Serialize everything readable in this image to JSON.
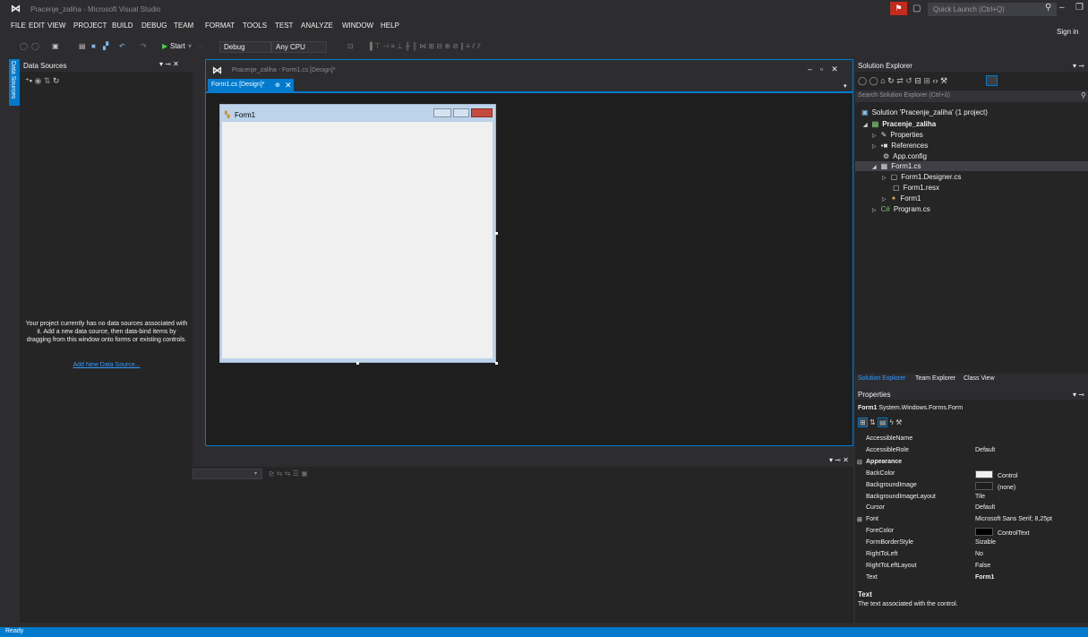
{
  "window": {
    "title": "Pracenje_zaliha - Microsoft Visual Studio",
    "quick_launch_placeholder": "Quick Launch (Ctrl+Q)",
    "sign_in": "Sign in"
  },
  "menu": [
    "FILE",
    "EDIT",
    "VIEW",
    "PROJECT",
    "BUILD",
    "DEBUG",
    "TEAM",
    "FORMAT",
    "TOOLS",
    "TEST",
    "ANALYZE",
    "WINDOW",
    "HELP"
  ],
  "toolbar": {
    "start_label": "Start",
    "config": "Debug",
    "platform": "Any CPU"
  },
  "data_sources": {
    "side_tab": "Data Sources",
    "title": "Data Sources",
    "empty_message": "Your project currently has no data sources associated with it. Add a new data source, then data-bind items by dragging from this window onto forms or existing controls.",
    "add_link": "Add New Data Source..."
  },
  "designer": {
    "doc_title": "Pracenje_zaliha - Form1.cs [Design]*",
    "tab_label": "Form1.cs [Design]*",
    "form_title": "Form1"
  },
  "solution_explorer": {
    "title": "Solution Explorer",
    "search_placeholder": "Search Solution Explorer (Ctrl+ŭ)",
    "nodes": {
      "solution": "Solution 'Pracenje_zaliha' (1 project)",
      "project": "Pracenje_zaliha",
      "properties": "Properties",
      "references": "References",
      "appconfig": "App.config",
      "form1cs": "Form1.cs",
      "designer": "Form1.Designer.cs",
      "resx": "Form1.resx",
      "form1": "Form1",
      "program": "Program.cs"
    },
    "tabs": [
      "Solution Explorer",
      "Team Explorer",
      "Class View"
    ]
  },
  "properties": {
    "title": "Properties",
    "object_name": "Form1",
    "object_type": "System.Windows.Forms.Form",
    "rows": [
      {
        "name": "AccessibleName",
        "value": ""
      },
      {
        "name": "AccessibleRole",
        "value": "Default"
      },
      {
        "category": "Appearance"
      },
      {
        "name": "BackColor",
        "value": "Control",
        "swatch": "#f0f0f0"
      },
      {
        "name": "BackgroundImage",
        "value": "(none)",
        "swatch": "#1e1e1e"
      },
      {
        "name": "BackgroundImageLayout",
        "value": "Tile"
      },
      {
        "name": "Cursor",
        "value": "Default"
      },
      {
        "name": "Font",
        "value": "Microsoft Sans Serif; 8,25pt",
        "expandable": true
      },
      {
        "name": "ForeColor",
        "value": "ControlText",
        "swatch": "#000000"
      },
      {
        "name": "FormBorderStyle",
        "value": "Sizable"
      },
      {
        "name": "RightToLeft",
        "value": "No"
      },
      {
        "name": "RightToLeftLayout",
        "value": "False"
      },
      {
        "name": "Text",
        "value": "Form1",
        "bold": true
      }
    ],
    "desc_name": "Text",
    "desc_text": "The text associated with the control."
  },
  "status": "Ready",
  "colors": {
    "accent": "#007acc",
    "background": "#2d2d30",
    "panel": "#252526",
    "editor": "#1e1e1e",
    "notification": "#c42b1c"
  }
}
